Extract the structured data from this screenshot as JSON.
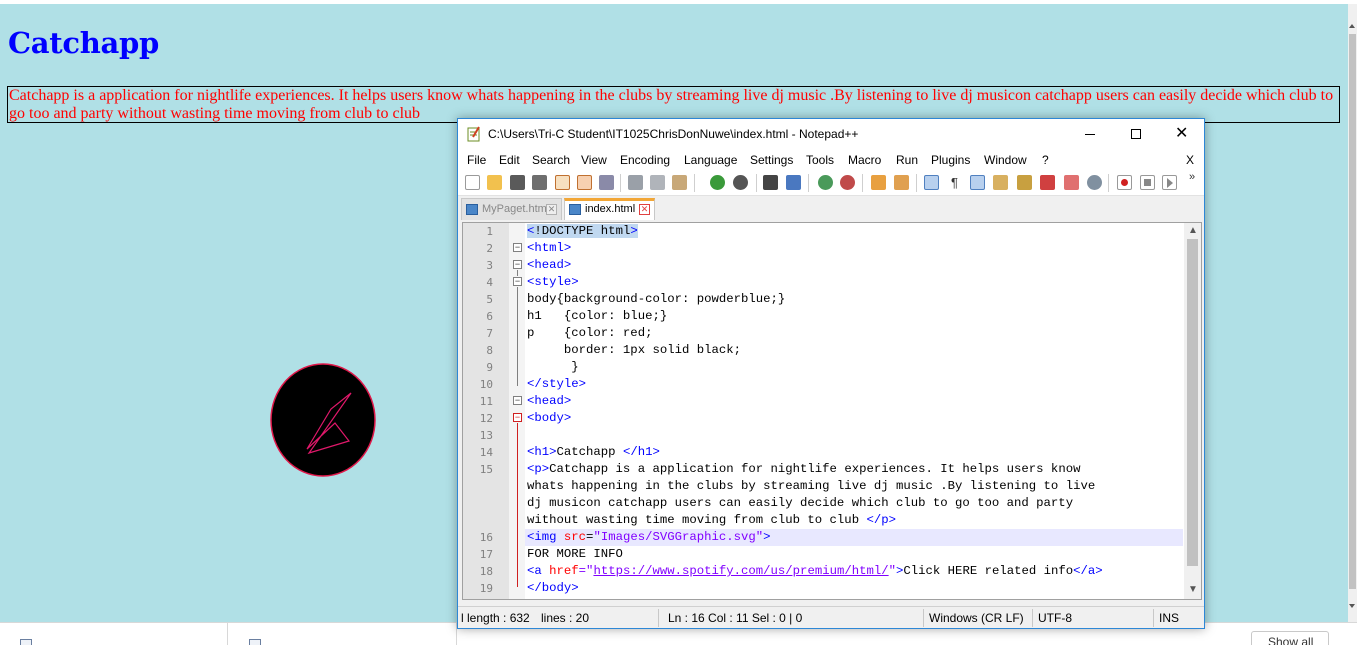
{
  "browser": {
    "background_color": "#b0e0e6",
    "heading": "Catchapp",
    "paragraph": "Catchapp is a application for nightlife experiences. It helps users know whats happening in the clubs by streaming live dj music .By listening to live dj musicon catchapp users can easily decide which club to go too and party without wasting time moving from club to club",
    "heading_color": "#0000ff",
    "paragraph_color": "#ff0000"
  },
  "downloads_bar": {
    "show_all_label": "Show all"
  },
  "notepad": {
    "title": "C:\\Users\\Tri-C Student\\IT1025ChrisDonNuwe\\index.html - Notepad++",
    "window_buttons": {
      "minimize": "minimize",
      "maximize": "maximize",
      "close": "✕"
    },
    "menu": [
      "File",
      "Edit",
      "Search",
      "View",
      "Encoding",
      "Language",
      "Settings",
      "Tools",
      "Macro",
      "Run",
      "Plugins",
      "Window",
      "?"
    ],
    "menu_close_doc": "X",
    "toolbar_icons": [
      "new-file-icon",
      "open-file-icon",
      "save-icon",
      "save-all-icon",
      "close-icon",
      "close-all-icon",
      "print-icon",
      "cut-icon",
      "copy-icon",
      "paste-icon",
      "undo-icon",
      "redo-icon",
      "find-icon",
      "replace-icon",
      "zoom-in-icon",
      "zoom-out-icon",
      "sync-vertical-icon",
      "sync-horizontal-icon",
      "word-wrap-icon",
      "show-all-chars-icon",
      "indent-guide-icon",
      "doc-map-icon",
      "function-list-icon",
      "folder-as-workspace-icon",
      "monitoring-icon",
      "record-macro-icon",
      "stop-macro-icon",
      "play-macro-icon"
    ],
    "toolbar_more": "»",
    "tabs": [
      {
        "label": "MyPaget.html",
        "active": false
      },
      {
        "label": "index.html",
        "active": true
      }
    ],
    "tab_close_glyph": "✕",
    "line_numbers": [
      "1",
      "2",
      "3",
      "4",
      "5",
      "6",
      "7",
      "8",
      "9",
      "10",
      "11",
      "12",
      "13",
      "14",
      "15",
      "",
      "",
      "",
      "16",
      "17",
      "18",
      "19"
    ],
    "code": {
      "l1": "!DOCTYPE html",
      "l2": "<html>",
      "l3": "<head>",
      "l4": "<style>",
      "l5": "body{background-color: powderblue;}",
      "l6": "h1   {color: blue;}",
      "l7": "p    {color: red;",
      "l8": "     border: 1px solid black;",
      "l9": "      }",
      "l10": "</style>",
      "l11": "<head>",
      "l12": "<body>",
      "l14_open": "<h1>",
      "l14_text": "Catchapp ",
      "l14_close": "</h1>",
      "l15_open": "<p>",
      "l15_text1": "Catchapp is a application for nightlife experiences. It helps users know",
      "l15_text2": "whats happening in the clubs by streaming live dj music .By listening to live",
      "l15_text3": "dj musicon catchapp users can easily decide which club to go too and party",
      "l15_text4": "without wasting time moving from club to club ",
      "l15_close": "</p>",
      "l16_open": "<img ",
      "l16_attr": "src",
      "l16_eq": "=",
      "l16_value": "\"Images/SVGGraphic.svg\"",
      "l16_close": ">",
      "l17": "FOR MORE INFO",
      "l18_open": "<a ",
      "l18_attr": "href",
      "l18_eq": "=\"",
      "l18_link": "https://www.spotify.com/us/premium/html/",
      "l18_q": "\"",
      "l18_close": ">",
      "l18_text": "Click HERE related info",
      "l18_end": "</a>",
      "l19": "</body>"
    },
    "status": {
      "length": "l length : 632",
      "lines": "lines : 20",
      "position": "Ln : 16   Col : 11   Sel : 0 | 0",
      "eol": "Windows (CR LF)",
      "encoding": "UTF-8",
      "mode": "INS"
    }
  }
}
